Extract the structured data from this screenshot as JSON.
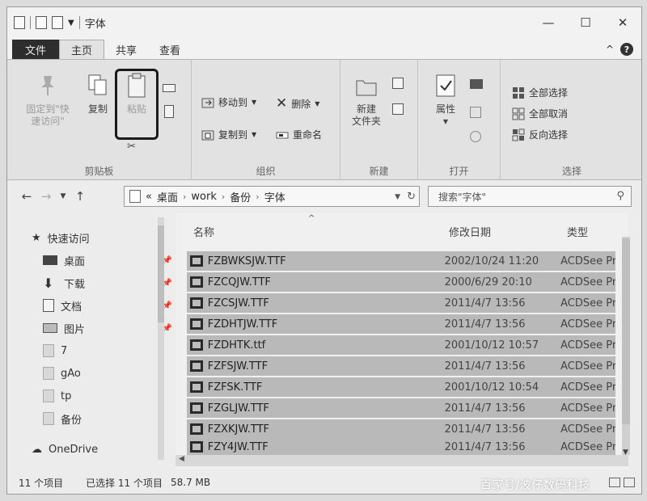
{
  "window": {
    "title": "字体"
  },
  "tabs": [
    {
      "label": "文件"
    },
    {
      "label": "主页"
    },
    {
      "label": "共享"
    },
    {
      "label": "查看"
    }
  ],
  "ribbon": {
    "clipboard": {
      "group_label": "剪贴板",
      "pin_label_1": "固定到\"快",
      "pin_label_2": "速访问\"",
      "copy_label": "复制",
      "paste_label": "粘贴"
    },
    "organize": {
      "group_label": "组织",
      "move_to": "移动到",
      "copy_to": "复制到",
      "delete": "删除",
      "rename": "重命名"
    },
    "new": {
      "group_label": "新建",
      "new_folder_1": "新建",
      "new_folder_2": "文件夹"
    },
    "open": {
      "group_label": "打开",
      "properties": "属性"
    },
    "select": {
      "group_label": "选择",
      "select_all": "全部选择",
      "select_none": "全部取消",
      "invert": "反向选择"
    }
  },
  "address": {
    "prefix": "«",
    "crumbs": [
      "桌面",
      "work",
      "备份",
      "字体"
    ]
  },
  "search": {
    "placeholder": "搜索\"字体\""
  },
  "nav": {
    "quick_access": "快速访问",
    "items": [
      {
        "label": "桌面",
        "pinned": true
      },
      {
        "label": "下载",
        "pinned": true
      },
      {
        "label": "文档",
        "pinned": true
      },
      {
        "label": "图片",
        "pinned": true
      },
      {
        "label": "7",
        "pinned": false
      },
      {
        "label": "gAo",
        "pinned": false
      },
      {
        "label": "tp",
        "pinned": false
      },
      {
        "label": "备份",
        "pinned": false
      }
    ],
    "onedrive": "OneDrive"
  },
  "columns": {
    "name": "名称",
    "date": "修改日期",
    "type": "类型"
  },
  "files": [
    {
      "name": "FZBWKSJW.TTF",
      "date": "2002/10/24 11:20",
      "type": "ACDSee Pr"
    },
    {
      "name": "FZCQJW.TTF",
      "date": "2000/6/29 20:10",
      "type": "ACDSee Pr"
    },
    {
      "name": "FZCSJW.TTF",
      "date": "2011/4/7 13:56",
      "type": "ACDSee Pr"
    },
    {
      "name": "FZDHTJW.TTF",
      "date": "2011/4/7 13:56",
      "type": "ACDSee Pr"
    },
    {
      "name": "FZDHTK.ttf",
      "date": "2001/10/12 10:57",
      "type": "ACDSee Pr"
    },
    {
      "name": "FZFSJW.TTF",
      "date": "2011/4/7 13:56",
      "type": "ACDSee Pr"
    },
    {
      "name": "FZFSK.TTF",
      "date": "2001/10/12 10:54",
      "type": "ACDSee Pr"
    },
    {
      "name": "FZGLJW.TTF",
      "date": "2011/4/7 13:56",
      "type": "ACDSee Pr"
    },
    {
      "name": "FZXKJW.TTF",
      "date": "2011/4/7 13:56",
      "type": "ACDSee Pr"
    },
    {
      "name": "FZY4JW.TTF",
      "date": "2011/4/7 13:56",
      "type": "ACDSee Pr"
    }
  ],
  "status": {
    "count": "11 个项目",
    "selected": "已选择 11 个项目",
    "size": "58.7 MB"
  },
  "watermark": "百家号/波仔数码科技"
}
